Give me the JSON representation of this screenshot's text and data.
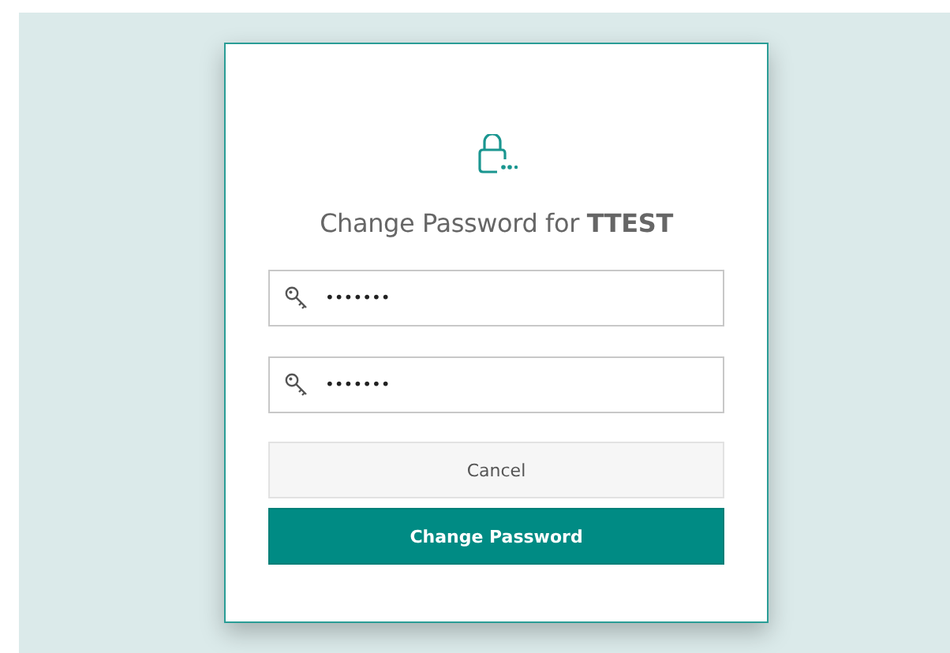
{
  "dialog": {
    "title": "Change Password for **TTEST**",
    "fields": [
      {
        "value": "•••••••"
      },
      {
        "value": "•••••••"
      }
    ],
    "buttons": [
      {
        "label": "Cancel",
        "kind": "secondary"
      },
      {
        "label": "Change Password",
        "kind": "primary"
      }
    ]
  }
}
